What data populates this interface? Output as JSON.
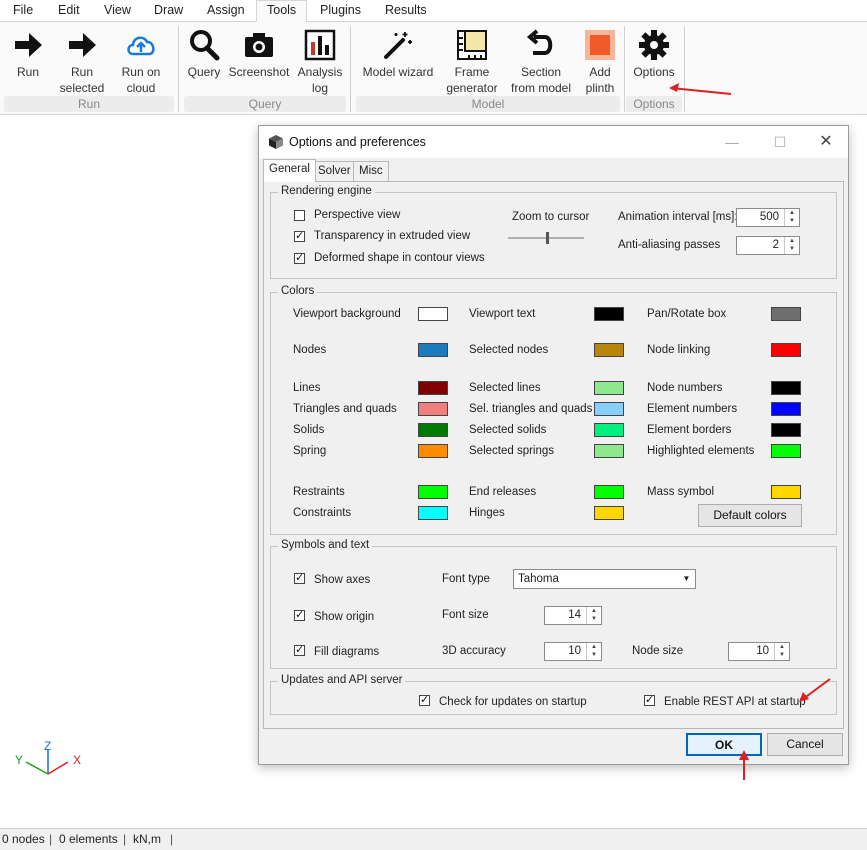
{
  "menu": [
    "File",
    "Edit",
    "View",
    "Draw",
    "Assign",
    "Tools",
    "Plugins",
    "Results"
  ],
  "ribbon": {
    "run": "Run",
    "run_selected_1": "Run",
    "run_selected_2": "selected",
    "run_cloud_1": "Run on",
    "run_cloud_2": "cloud",
    "group_run": "Run",
    "query": "Query",
    "screenshot": "Screenshot",
    "analysis_1": "Analysis",
    "analysis_2": "log",
    "group_query": "Query",
    "model_wizard": "Model wizard",
    "frame_1": "Frame",
    "frame_2": "generator",
    "section_1": "Section",
    "section_2": "from model",
    "plinth_1": "Add",
    "plinth_2": "plinth",
    "group_model": "Model",
    "options": "Options",
    "group_options": "Options"
  },
  "dialog": {
    "title": "Options and preferences",
    "tabs": [
      "General",
      "Solver",
      "Misc"
    ],
    "rendering": {
      "legend": "Rendering engine",
      "perspective": "Perspective view",
      "transparency": "Transparency in extruded view",
      "deformed": "Deformed shape in contour views",
      "zoom": "Zoom to cursor",
      "anim_label": "Animation interval [ms]:",
      "anim_value": "500",
      "aa_label": "Anti-aliasing passes",
      "aa_value": "2"
    },
    "colors": {
      "legend": "Colors",
      "items": [
        {
          "label": "Viewport background",
          "color": "#ffffff"
        },
        {
          "label": "Viewport text",
          "color": "#000000"
        },
        {
          "label": "Pan/Rotate box",
          "color": "#6e6e6e"
        },
        {
          "label": "Nodes",
          "color": "#1a7bbd"
        },
        {
          "label": "Selected nodes",
          "color": "#b8860b"
        },
        {
          "label": "Node linking",
          "color": "#ff0000"
        },
        {
          "label": "Lines",
          "color": "#800000"
        },
        {
          "label": "Selected lines",
          "color": "#8ee88e"
        },
        {
          "label": "Node numbers",
          "color": "#000000"
        },
        {
          "label": "Triangles and quads",
          "color": "#f08080"
        },
        {
          "label": "Sel. triangles and quads",
          "color": "#87cefa"
        },
        {
          "label": "Element numbers",
          "color": "#0000ff"
        },
        {
          "label": "Solids",
          "color": "#007a00"
        },
        {
          "label": "Selected solids",
          "color": "#00f07f"
        },
        {
          "label": "Element borders",
          "color": "#000000"
        },
        {
          "label": "Spring",
          "color": "#ff8c00"
        },
        {
          "label": "Selected springs",
          "color": "#8ee88e"
        },
        {
          "label": "Highlighted elements",
          "color": "#00ff00"
        },
        {
          "label": "Restraints",
          "color": "#00ff00"
        },
        {
          "label": "End releases",
          "color": "#00ff00"
        },
        {
          "label": "Mass symbol",
          "color": "#ffd700"
        },
        {
          "label": "Constraints",
          "color": "#00ffff"
        },
        {
          "label": "Hinges",
          "color": "#ffd700"
        }
      ],
      "default_button": "Default colors"
    },
    "symbols": {
      "legend": "Symbols and text",
      "show_axes": "Show axes",
      "show_origin": "Show origin",
      "fill_diagrams": "Fill diagrams",
      "font_type_label": "Font type",
      "font_type_value": "Tahoma",
      "font_size_label": "Font size",
      "font_size_value": "14",
      "accuracy_label": "3D accuracy",
      "accuracy_value": "10",
      "node_size_label": "Node size",
      "node_size_value": "10"
    },
    "updates": {
      "legend": "Updates and API server",
      "check_updates": "Check for updates on startup",
      "rest_api": "Enable REST API at startup"
    },
    "ok": "OK",
    "cancel": "Cancel"
  },
  "axes": {
    "y": "Y",
    "z": "Z",
    "x": "X"
  },
  "status": {
    "nodes": "0 nodes",
    "elements": "0 elements",
    "units": "kN,m"
  },
  "colors_ui": {
    "accent_arrow": "#e02020"
  }
}
